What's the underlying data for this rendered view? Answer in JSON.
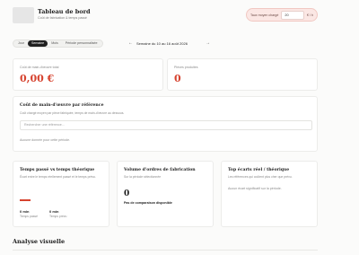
{
  "header": {
    "title": "Tableau de bord",
    "subtitle": "Coût de fabrication & temps passé",
    "rate_label": "Taux moyen chargé",
    "rate_value": "20",
    "rate_unit": "€ / h"
  },
  "periods": {
    "items": [
      "Jour",
      "Semaine",
      "Mois",
      "Période personnalisée"
    ],
    "active": "Semaine",
    "prev_arrow": "←",
    "next_arrow": "→",
    "week_label": "Semaine du 10 au 16 août 2026"
  },
  "kpis": {
    "labor_cost_label": "Coût de main-d'œuvre total",
    "labor_cost_value": "0,00 €",
    "produced_label": "Pièces produites",
    "produced_value": "0"
  },
  "reference_section": {
    "title": "Coût de main-d'œuvre par référence",
    "subtitle": "Coût chargé moyen par pièce fabriquée, temps de main-d'œuvre au dessous.",
    "search_placeholder": "Rechercher une référence...",
    "empty_text": "Aucune donnée pour cette période."
  },
  "time_card": {
    "title": "Temps passé vs temps théorique",
    "subtitle": "Écart entre le temps réellement passé et le temps prévu.",
    "actual_value": "0 min",
    "actual_label": "Temps passé",
    "theoretical_value": "0 min",
    "theoretical_label": "Temps prévu"
  },
  "volume_card": {
    "title": "Volume d'ordres de fabrication",
    "subtitle": "Sur la période sélectionnée",
    "value": "0",
    "note": "Pas de comparaison disponible"
  },
  "gaps_card": {
    "title": "Top écarts réel / théorique",
    "subtitle": "Les références qui coûtent plus cher que prévu.",
    "empty_text": "Aucun écart significatif sur la période."
  },
  "visual": {
    "title": "Analyse visuelle"
  },
  "colors": {
    "accent_red": "#d6432f",
    "rate_bg": "#fbe7e4",
    "active_pill": "#1f1f1f"
  }
}
